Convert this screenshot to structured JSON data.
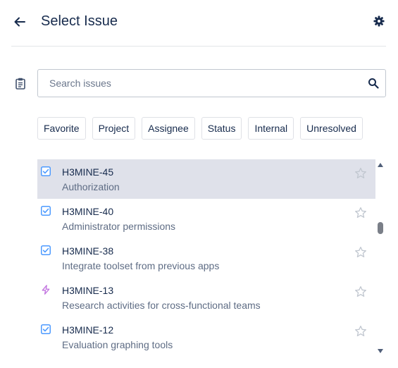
{
  "header": {
    "title": "Select Issue",
    "back_icon": "arrow-left-icon",
    "settings_icon": "gear-icon"
  },
  "search": {
    "placeholder": "Search issues",
    "value": "",
    "side_icon": "clipboard-icon",
    "button_icon": "search-icon"
  },
  "filters": [
    "Favorite",
    "Project",
    "Assignee",
    "Status",
    "Internal",
    "Unresolved"
  ],
  "issues": [
    {
      "key": "H3MINE-45",
      "summary": "Authorization",
      "type_icon": "checkbox-icon",
      "selected": true
    },
    {
      "key": "H3MINE-40",
      "summary": "Administrator permissions",
      "type_icon": "checkbox-icon",
      "selected": false
    },
    {
      "key": "H3MINE-38",
      "summary": "Integrate toolset from previous apps",
      "type_icon": "checkbox-icon",
      "selected": false
    },
    {
      "key": "H3MINE-13",
      "summary": "Research activities for cross-functional teams",
      "type_icon": "lightning-icon",
      "selected": false
    },
    {
      "key": "H3MINE-12",
      "summary": "Evaluation graphing tools",
      "type_icon": "checkbox-icon",
      "selected": false
    }
  ],
  "colors": {
    "selected_row": "#dfe1ea",
    "task_icon": "#4c9aff",
    "lightning_icon": "#c377e0",
    "star_outline": "#c1c7d0"
  }
}
